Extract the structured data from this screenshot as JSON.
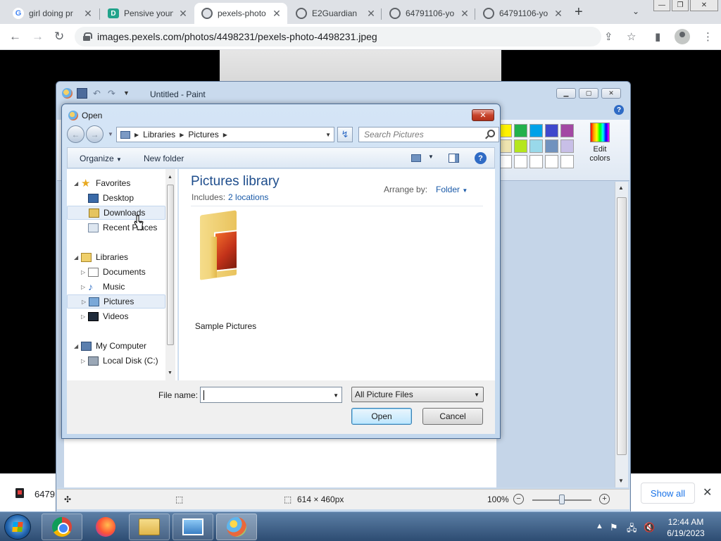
{
  "browser": {
    "tabs": [
      {
        "title": "girl doing pr",
        "favicon": "google-icon",
        "active": false
      },
      {
        "title": "Pensive youn",
        "favicon": "d-icon",
        "active": false
      },
      {
        "title": "pexels-photo",
        "favicon": "globe-icon",
        "active": true
      },
      {
        "title": "E2Guardian",
        "favicon": "globe-icon",
        "active": false
      },
      {
        "title": "64791106-yo",
        "favicon": "globe-icon",
        "active": false
      },
      {
        "title": "64791106-yo",
        "favicon": "globe-icon",
        "active": false
      }
    ],
    "url": "images.pexels.com/photos/4498231/pexels-photo-4498231.jpeg"
  },
  "paint": {
    "window_title": "Untitled - Paint",
    "edit_colors_line1": "Edit",
    "edit_colors_line2": "colors",
    "palette": [
      "#fff200",
      "#22b14c",
      "#00a2e8",
      "#3f48cc",
      "#a349a4",
      "#efe4b0",
      "#b5e61d",
      "#99d9ea",
      "#7092be",
      "#c8bfe7",
      "#ffffff",
      "#ffffff",
      "#ffffff",
      "#ffffff",
      "#ffffff"
    ],
    "status": {
      "dimensions": "614 × 460px",
      "zoom": "100%",
      "zoom_level": 1.0
    }
  },
  "dialog": {
    "title": "Open",
    "breadcrumb": [
      "Libraries",
      "Pictures"
    ],
    "search_placeholder": "Search Pictures",
    "toolbar": {
      "organize": "Organize",
      "new_folder": "New folder"
    },
    "nav": {
      "favorites": "Favorites",
      "desktop": "Desktop",
      "downloads": "Downloads",
      "recent_places": "Recent Places",
      "libraries": "Libraries",
      "documents": "Documents",
      "music": "Music",
      "pictures": "Pictures",
      "videos": "Videos",
      "my_computer": "My Computer",
      "local_disk": "Local Disk (C:)"
    },
    "content": {
      "title": "Pictures library",
      "includes_label": "Includes:",
      "locations_link": "2 locations",
      "arrange_label": "Arrange by:",
      "arrange_value": "Folder",
      "folder_name": "Sample Pictures"
    },
    "file_name_label": "File name:",
    "file_name_value": "",
    "file_type": "All Picture Files",
    "open_label": "Open",
    "cancel_label": "Cancel"
  },
  "downloads": {
    "file": "6479",
    "show_all": "Show all"
  },
  "taskbar": {
    "time": "12:44 AM",
    "date": "6/19/2023"
  }
}
